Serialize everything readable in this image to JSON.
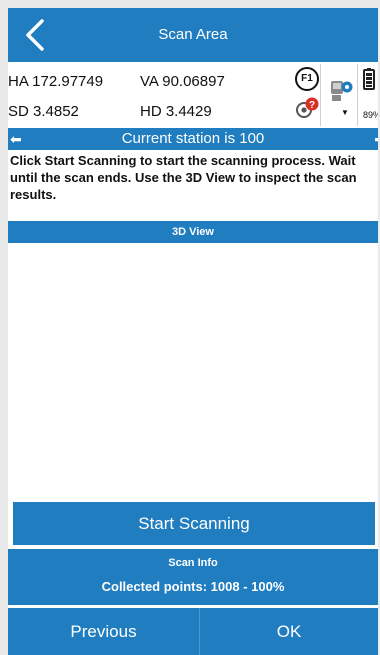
{
  "header": {
    "title": "Scan Area",
    "back_icon": "chevron-left-icon"
  },
  "readings": {
    "ha": "HA 172.97749",
    "va": "VA 90.06897",
    "sd": "SD 3.4852",
    "hd": "HD 3.4429"
  },
  "status_icons": {
    "f1_label": "F1",
    "battery_percent": "89%"
  },
  "station_bar": {
    "text": "Current station is 100"
  },
  "instructions": "Click Start Scanning to start the scanning process. Wait until the scan ends. Use the 3D View to inspect the scan results.",
  "view": {
    "label": "3D View"
  },
  "start_button": {
    "label": "Start Scanning"
  },
  "scan_info": {
    "title": "Scan Info",
    "collected": "Collected points: 1008 - 100%"
  },
  "footer": {
    "previous": "Previous",
    "ok": "OK"
  },
  "colors": {
    "primary": "#1f7dc0",
    "background": "#ffffff"
  }
}
